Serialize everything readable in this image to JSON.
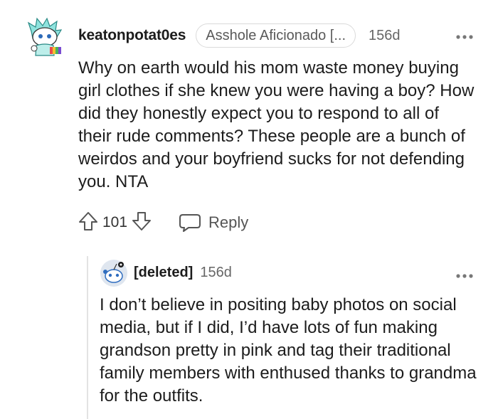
{
  "comment": {
    "author": "keatonpotat0es",
    "flair": "Asshole Aficionado [...",
    "age": "156d",
    "more_icon": "more-dots-icon",
    "body": "Why on earth would his mom waste money buying girl clothes if she knew you were having a boy? How did they honestly expect you to respond to all of their rude comments? These people are a bunch of weirdos and your boyfriend sucks for not defending you. NTA",
    "upvote_icon": "upvote-arrow-icon",
    "score": "101",
    "downvote_icon": "downvote-arrow-icon",
    "reply_icon": "chat-bubble-icon",
    "reply_label": "Reply"
  },
  "reply": {
    "author": "[deleted]",
    "age": "156d",
    "more_icon": "more-dots-icon",
    "body": "I don’t believe in positing baby photos on social media, but if I did, I’d have lots of fun making grandson pretty in pink and tag their traditional family members with enthused thanks to grandma for the outfits."
  },
  "colors": {
    "text": "#1c1c1c",
    "meta": "#666666",
    "flair_border": "#dadada",
    "thread_line": "#e3e3e3",
    "avatar_teal": "#6fd6d0",
    "avatar_blue": "#2f6dbf"
  }
}
